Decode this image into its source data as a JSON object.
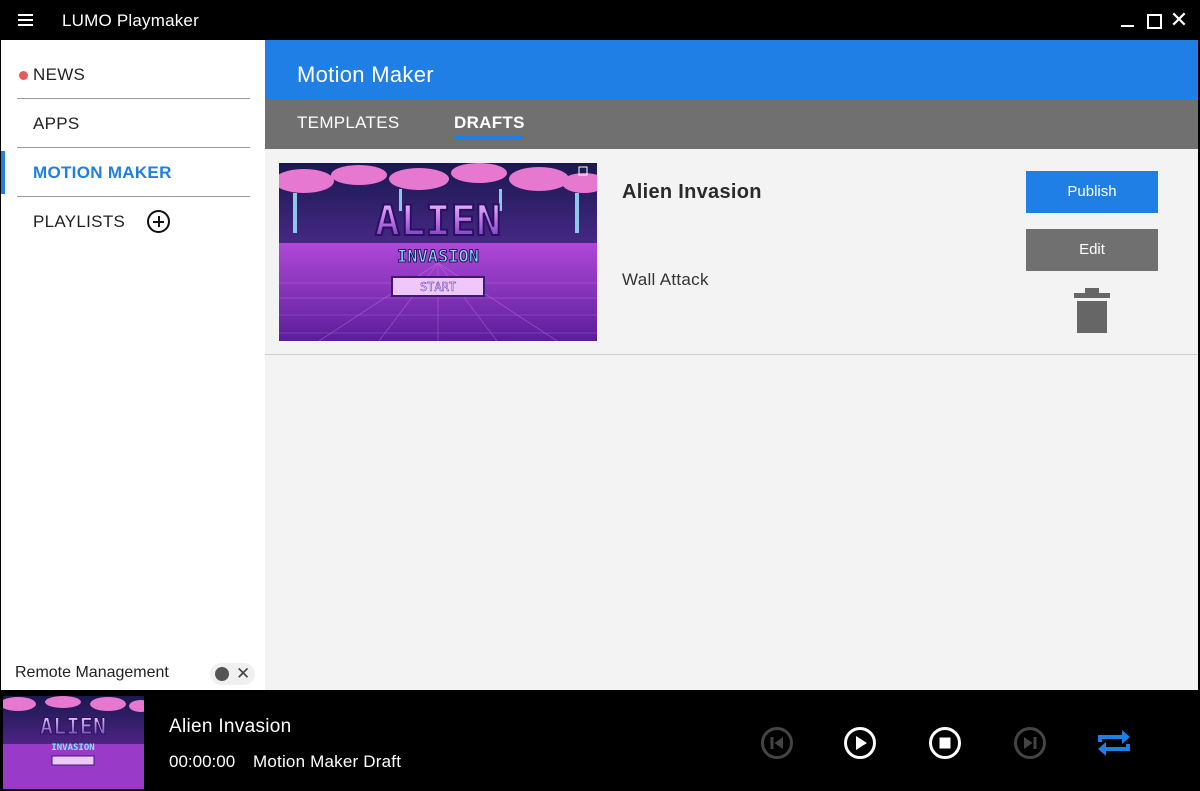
{
  "app": {
    "title": "LUMO Playmaker"
  },
  "sidebar": {
    "items": [
      {
        "label": "NEWS",
        "has_notification": true
      },
      {
        "label": "APPS"
      },
      {
        "label": "MOTION MAKER",
        "active": true
      },
      {
        "label": "PLAYLISTS"
      }
    ],
    "remote_management": {
      "label": "Remote Management",
      "enabled": false
    }
  },
  "header": {
    "title": "Motion Maker"
  },
  "tabs": [
    {
      "label": "TEMPLATES",
      "active": false
    },
    {
      "label": "DRAFTS",
      "active": true
    }
  ],
  "drafts": [
    {
      "title": "Alien Invasion",
      "template": "Wall Attack",
      "thumbnail": {
        "title_text": "ALIEN",
        "subtitle_text": "INVASION",
        "button_text": "START"
      },
      "publish_label": "Publish",
      "edit_label": "Edit"
    }
  ],
  "player": {
    "title": "Alien Invasion",
    "time": "00:00:00",
    "source": "Motion Maker Draft",
    "repeat_enabled": true
  },
  "colors": {
    "accent": "#1f7fe5",
    "tab_bar": "#707070",
    "notification": "#e85a5a",
    "content_bg": "#f3f3f3"
  },
  "icons": {
    "menu": "hamburger-menu-icon",
    "add": "add-circle-icon",
    "delete": "trash-icon",
    "prev": "skip-previous-icon",
    "play": "play-icon",
    "stop": "stop-icon",
    "next": "skip-next-icon",
    "repeat": "repeat-icon"
  }
}
